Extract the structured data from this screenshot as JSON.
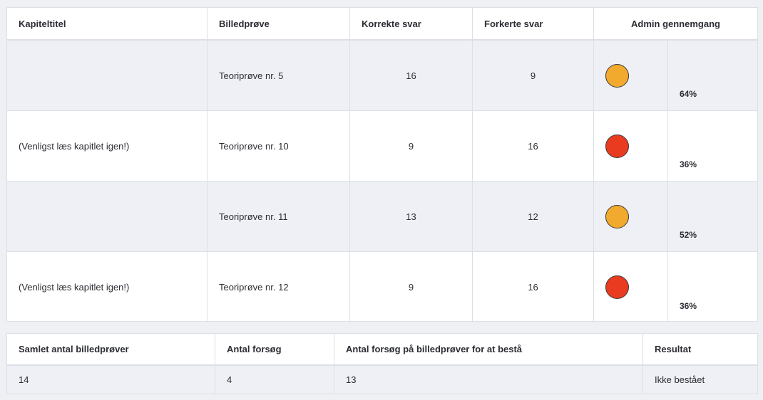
{
  "chapters_table": {
    "headers": {
      "chapter_title": "Kapiteltitel",
      "image_test": "Billedprøve",
      "correct": "Korrekte svar",
      "wrong": "Forkerte svar",
      "admin_review": "Admin gennemgang"
    },
    "rows": [
      {
        "chapter_title": "",
        "image_test": "Teoriprøve nr. 5",
        "correct": "16",
        "wrong": "9",
        "status_color": "#f2aa2e",
        "status_icon": "yellow-status-dot",
        "percent": "64%"
      },
      {
        "chapter_title": "(Venligst læs kapitlet igen!)",
        "image_test": "Teoriprøve nr. 10",
        "correct": "9",
        "wrong": "16",
        "status_color": "#e83b1f",
        "status_icon": "red-status-dot",
        "percent": "36%"
      },
      {
        "chapter_title": "",
        "image_test": "Teoriprøve nr. 11",
        "correct": "13",
        "wrong": "12",
        "status_color": "#f2aa2e",
        "status_icon": "yellow-status-dot",
        "percent": "52%"
      },
      {
        "chapter_title": "(Venligst læs kapitlet igen!)",
        "image_test": "Teoriprøve nr. 12",
        "correct": "9",
        "wrong": "16",
        "status_color": "#e83b1f",
        "status_icon": "red-status-dot",
        "percent": "36%"
      }
    ]
  },
  "summary_table": {
    "headers": {
      "total": "Samlet antal billedprøver",
      "attempts": "Antal forsøg",
      "attempts_to_pass": "Antal forsøg på billedprøver for at bestå",
      "result": "Resultat"
    },
    "values": {
      "total": "14",
      "attempts": "4",
      "attempts_to_pass": "13",
      "result": "Ikke bestået"
    }
  }
}
